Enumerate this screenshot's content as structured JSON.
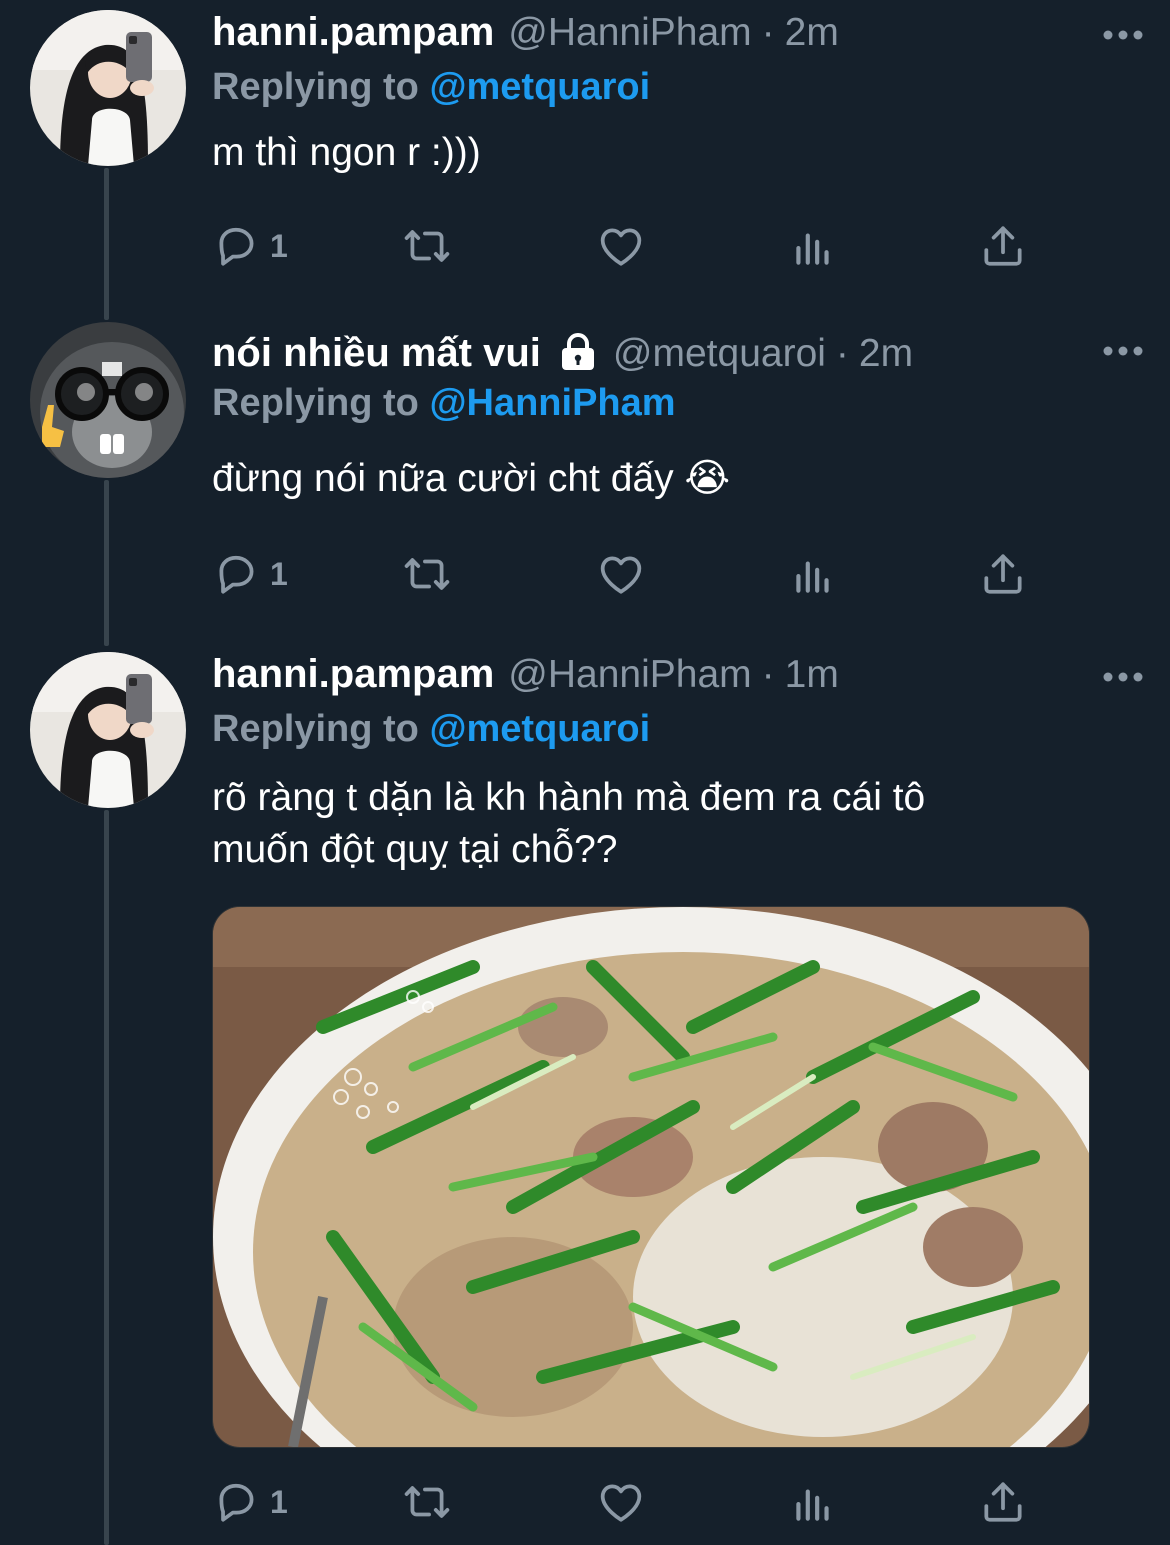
{
  "colors": {
    "background": "#15202b",
    "text_primary": "#ffffff",
    "text_secondary": "#8b98a5",
    "mention": "#1d9bf0",
    "thread_line": "#38444d"
  },
  "tweets": [
    {
      "display_name": "hanni.pampam",
      "handle": "@HanniPham",
      "separator": "·",
      "time": "2m",
      "replying_prefix": "Replying to",
      "replying_to": "@metquaroi",
      "text": "m thì ngon r :)))",
      "reply_count": "1",
      "avatar": "avatar-photo-girl"
    },
    {
      "display_name": "nói nhiều mất vui",
      "protected": true,
      "handle": "@metquaroi",
      "separator": "·",
      "time": "2m",
      "replying_prefix": "Replying to",
      "replying_to": "@HanniPham",
      "text": "đừng nói nữa cười cht đấy 😭",
      "reply_count": "1",
      "avatar": "avatar-cat-glasses"
    },
    {
      "display_name": "hanni.pampam",
      "handle": "@HanniPham",
      "separator": "·",
      "time": "1m",
      "replying_prefix": "Replying to",
      "replying_to": "@metquaroi",
      "text_line1": "rõ ràng t dặn là kh hành mà đem ra cái tô",
      "text_line2": "muốn đột quỵ tại chỗ??",
      "reply_count": "1",
      "avatar": "avatar-photo-girl",
      "media": "pho-bowl-photo"
    }
  ],
  "icons": [
    "reply-icon",
    "retweet-icon",
    "like-icon",
    "analytics-icon",
    "share-icon",
    "more-icon",
    "lock-icon"
  ]
}
